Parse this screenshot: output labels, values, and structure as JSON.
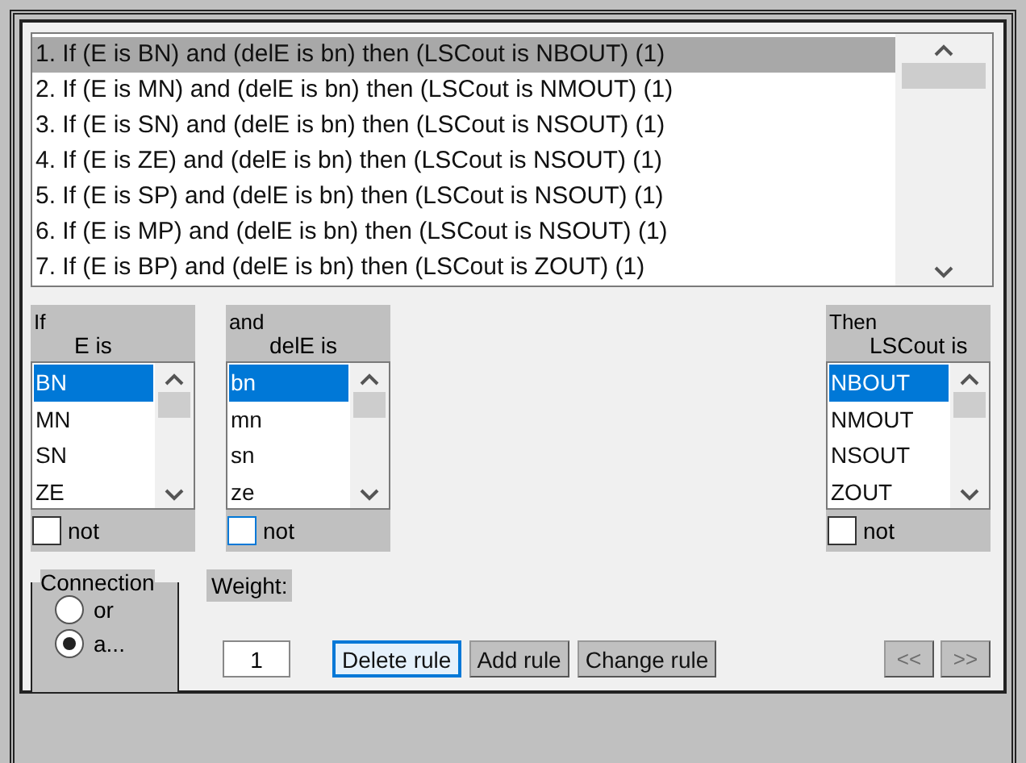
{
  "rules": [
    {
      "text": "1. If (E is BN) and (delE is bn) then (LSCout is NBOUT) (1)",
      "selected": true
    },
    {
      "text": "2. If (E is MN) and (delE is bn) then (LSCout is NMOUT) (1)",
      "selected": false
    },
    {
      "text": "3. If (E is SN) and (delE is bn) then (LSCout is NSOUT) (1)",
      "selected": false
    },
    {
      "text": "4. If (E is ZE) and (delE is bn) then (LSCout is NSOUT) (1)",
      "selected": false
    },
    {
      "text": "5. If (E is SP) and (delE is bn) then (LSCout is NSOUT) (1)",
      "selected": false
    },
    {
      "text": "6. If (E is MP) and (delE is bn) then (LSCout is NSOUT) (1)",
      "selected": false
    },
    {
      "text": "7. If (E is BP) and (delE is bn) then (LSCout is ZOUT) (1)",
      "selected": false
    }
  ],
  "selectors": [
    {
      "kind": "input",
      "heading": "If",
      "variable": "E is",
      "items": [
        {
          "label": "BN",
          "selected": true
        },
        {
          "label": "MN",
          "selected": false
        },
        {
          "label": "SN",
          "selected": false
        },
        {
          "label": "ZE",
          "selected": false
        }
      ],
      "not": {
        "label": "not",
        "checked": false,
        "focused": false
      }
    },
    {
      "kind": "input",
      "heading": "and",
      "variable": "delE is",
      "items": [
        {
          "label": "bn",
          "selected": true
        },
        {
          "label": "mn",
          "selected": false
        },
        {
          "label": "sn",
          "selected": false
        },
        {
          "label": "ze",
          "selected": false
        }
      ],
      "not": {
        "label": "not",
        "checked": false,
        "focused": true
      }
    },
    {
      "kind": "output",
      "heading": "Then",
      "variable": "LSCout is",
      "items": [
        {
          "label": "NBOUT",
          "selected": true
        },
        {
          "label": "NMOUT",
          "selected": false
        },
        {
          "label": "NSOUT",
          "selected": false
        },
        {
          "label": "ZOUT",
          "selected": false
        }
      ],
      "not": {
        "label": "not",
        "checked": false,
        "focused": false
      }
    }
  ],
  "connection": {
    "title": "Connection",
    "options": [
      {
        "label": "or",
        "selected": false
      },
      {
        "label": "a...",
        "selected": true
      }
    ]
  },
  "weight": {
    "label": "Weight:",
    "value": "1"
  },
  "buttons": [
    {
      "label": "Delete rule",
      "focused": true,
      "disabled": false
    },
    {
      "label": "Add rule",
      "focused": false,
      "disabled": false
    },
    {
      "label": "Change rule",
      "focused": false,
      "disabled": false
    }
  ],
  "nav": [
    {
      "label": "<<",
      "disabled": true
    },
    {
      "label": ">>",
      "disabled": true
    }
  ]
}
